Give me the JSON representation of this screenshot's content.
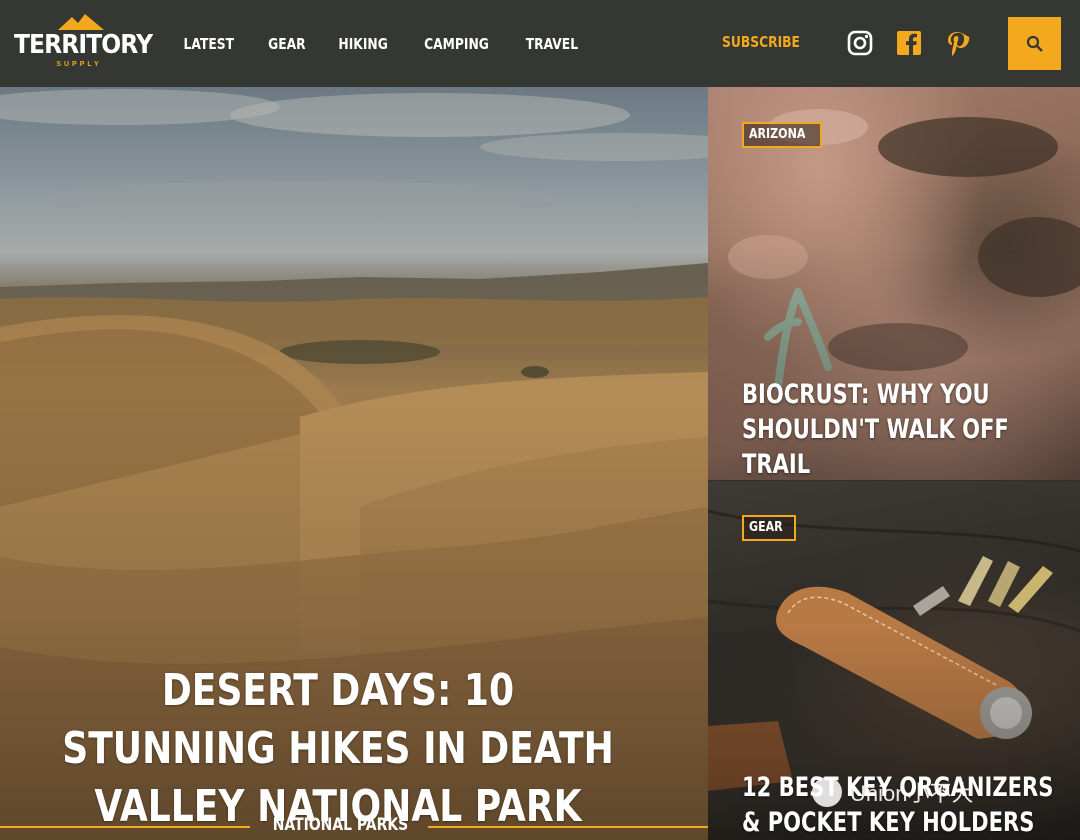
{
  "header": {
    "logo": {
      "wordmark": "TERRITORY",
      "tagline": "SUPPLY"
    },
    "nav": [
      "LATEST",
      "GEAR",
      "HIKING",
      "CAMPING",
      "TRAVEL"
    ],
    "subscribe_label": "SUBSCRIBE",
    "social_icons": [
      "instagram-icon",
      "facebook-icon",
      "pinterest-icon"
    ],
    "search_icon": "search-icon"
  },
  "hero": {
    "title": "DESERT DAYS: 10 STUNNING HIKES IN DEATH VALLEY NATIONAL PARK",
    "category": "NATIONAL PARKS"
  },
  "cards": [
    {
      "tag": "ARIZONA",
      "title": "BIOCRUST: WHY YOU SHOULDN'T WALK OFF TRAIL"
    },
    {
      "tag": "GEAR",
      "title": "12 BEST KEY ORGANIZERS & POCKET KEY HOLDERS"
    }
  ],
  "watermark": "Union小不大",
  "colors": {
    "header_bg": "#353832",
    "accent": "#f3a81d",
    "text": "#ffffff"
  }
}
